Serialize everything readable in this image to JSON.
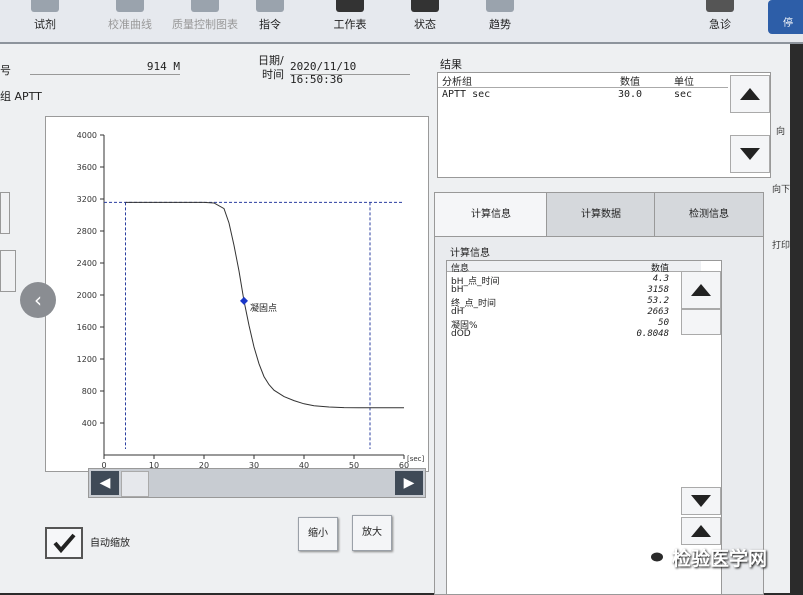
{
  "toolbar": {
    "buttons": [
      "试剂",
      "校准曲线",
      "质量控制图表",
      "指令",
      "工作表",
      "状态",
      "趋势",
      "急诊"
    ],
    "blue_label": "停"
  },
  "sample": {
    "id_label": "号",
    "id_value": "914 M",
    "datetime_label_1": "日期/",
    "datetime_label_2": "时间",
    "datetime_value": "2020/11/10 16:50:36",
    "group_label": "组 APTT"
  },
  "chart_data": {
    "type": "line",
    "xlabel": "[sec]",
    "xlim": [
      0,
      60
    ],
    "ylim": [
      0,
      4000
    ],
    "x_ticks": [
      0,
      10,
      20,
      30,
      40,
      50,
      60
    ],
    "y_ticks": [
      400,
      800,
      1200,
      1600,
      2000,
      2400,
      2800,
      3200,
      3600,
      4000
    ],
    "baseline_y": 3158,
    "vlines_x": [
      4.3,
      53.2
    ],
    "clot_point": {
      "x": 28.0,
      "y": 1926,
      "label": "凝固点"
    },
    "series": [
      {
        "x": [
          4.3,
          10,
          15,
          20,
          22,
          24,
          25,
          26,
          27,
          28,
          29,
          30,
          31,
          32,
          33,
          34,
          36,
          38,
          40,
          42,
          45,
          48,
          51,
          53.2,
          60
        ],
        "y": [
          3158,
          3158,
          3158,
          3158,
          3150,
          3080,
          2900,
          2620,
          2300,
          1926,
          1620,
          1350,
          1140,
          980,
          880,
          810,
          730,
          680,
          640,
          615,
          600,
          592,
          590,
          590,
          590
        ]
      }
    ]
  },
  "controls": {
    "auto_zoom_label": "自动缩放",
    "shrink_label": "缩小",
    "enlarge_label": "放大",
    "scroll_left": "◀",
    "scroll_right": "▶"
  },
  "results": {
    "title": "结果",
    "headers": [
      "分析组",
      "数值",
      "单位"
    ],
    "rows": [
      {
        "group": "APTT sec",
        "value": "30.0",
        "unit": "sec"
      }
    ]
  },
  "tabs": [
    "计算信息",
    "计算数据",
    "检测信息"
  ],
  "calc": {
    "title": "计算信息",
    "headers": [
      "信息",
      "数值"
    ],
    "rows": [
      {
        "name": "bH_点_时间",
        "value": "4.3"
      },
      {
        "name": "bH",
        "value": "3158"
      },
      {
        "name": "终_点_时间",
        "value": "53.2"
      },
      {
        "name": "dH",
        "value": "2663"
      },
      {
        "name": "凝固%",
        "value": "50"
      },
      {
        "name": "dOD",
        "value": "0.8048"
      }
    ]
  },
  "side": {
    "right_labels": [
      "向",
      "向下",
      "打印"
    ]
  },
  "watermark": "检验医学网",
  "colors": {
    "curve": "#333333",
    "dashed": "#2b3fa0",
    "clot_point": "#1a37c8",
    "toolbar_blue": "#2d5ea8"
  }
}
